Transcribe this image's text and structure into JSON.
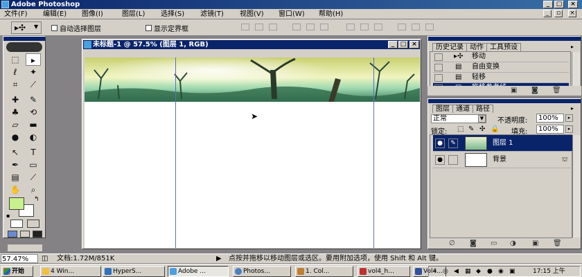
{
  "window": {
    "title": "Adobe Photoshop"
  },
  "menu": [
    "文件(F)",
    "编辑(E)",
    "图像(I)",
    "图层(L)",
    "选择(S)",
    "滤镜(T)",
    "视图(V)",
    "窗口(W)",
    "帮助(H)"
  ],
  "options": {
    "auto_select_label": "自动选择图层",
    "show_bounds_label": "显示定界框"
  },
  "document": {
    "title": "未标题-1 @ 57.5% (图层 1, RGB)"
  },
  "colors": {
    "foreground": "#c8f08c",
    "background": "#ffffff",
    "titlebar": "#0a246a"
  },
  "history_panel": {
    "tabs": [
      "历史记录",
      "动作",
      "工具预设"
    ],
    "items": [
      {
        "label": "移动",
        "selected": false
      },
      {
        "label": "自由变换",
        "selected": false
      },
      {
        "label": "轻移",
        "selected": false
      },
      {
        "label": "拖移参考线",
        "selected": true
      }
    ]
  },
  "layers_panel": {
    "tabs": [
      "图层",
      "通道",
      "路径"
    ],
    "blend_mode": "正常",
    "opacity_label": "不透明度:",
    "opacity_value": "100%",
    "lock_label": "锁定:",
    "fill_label": "填充:",
    "fill_value": "100%",
    "layers": [
      {
        "name": "图层 1",
        "selected": true
      },
      {
        "name": "背景",
        "selected": false
      }
    ]
  },
  "status": {
    "zoom": "57.47%",
    "doc_info": "文档:1.72M/851K",
    "hint": "点按并拖移以移动图层或选区。要用附加选项，使用 Shift 和 Alt 键。"
  },
  "taskbar": {
    "start": "开始",
    "items": [
      "4 Win...",
      "HyperS...",
      "Adobe ...",
      "Photos...",
      "1. Col...",
      "vol4_h...",
      "Vol4..."
    ],
    "clock": "17:15 上午"
  }
}
